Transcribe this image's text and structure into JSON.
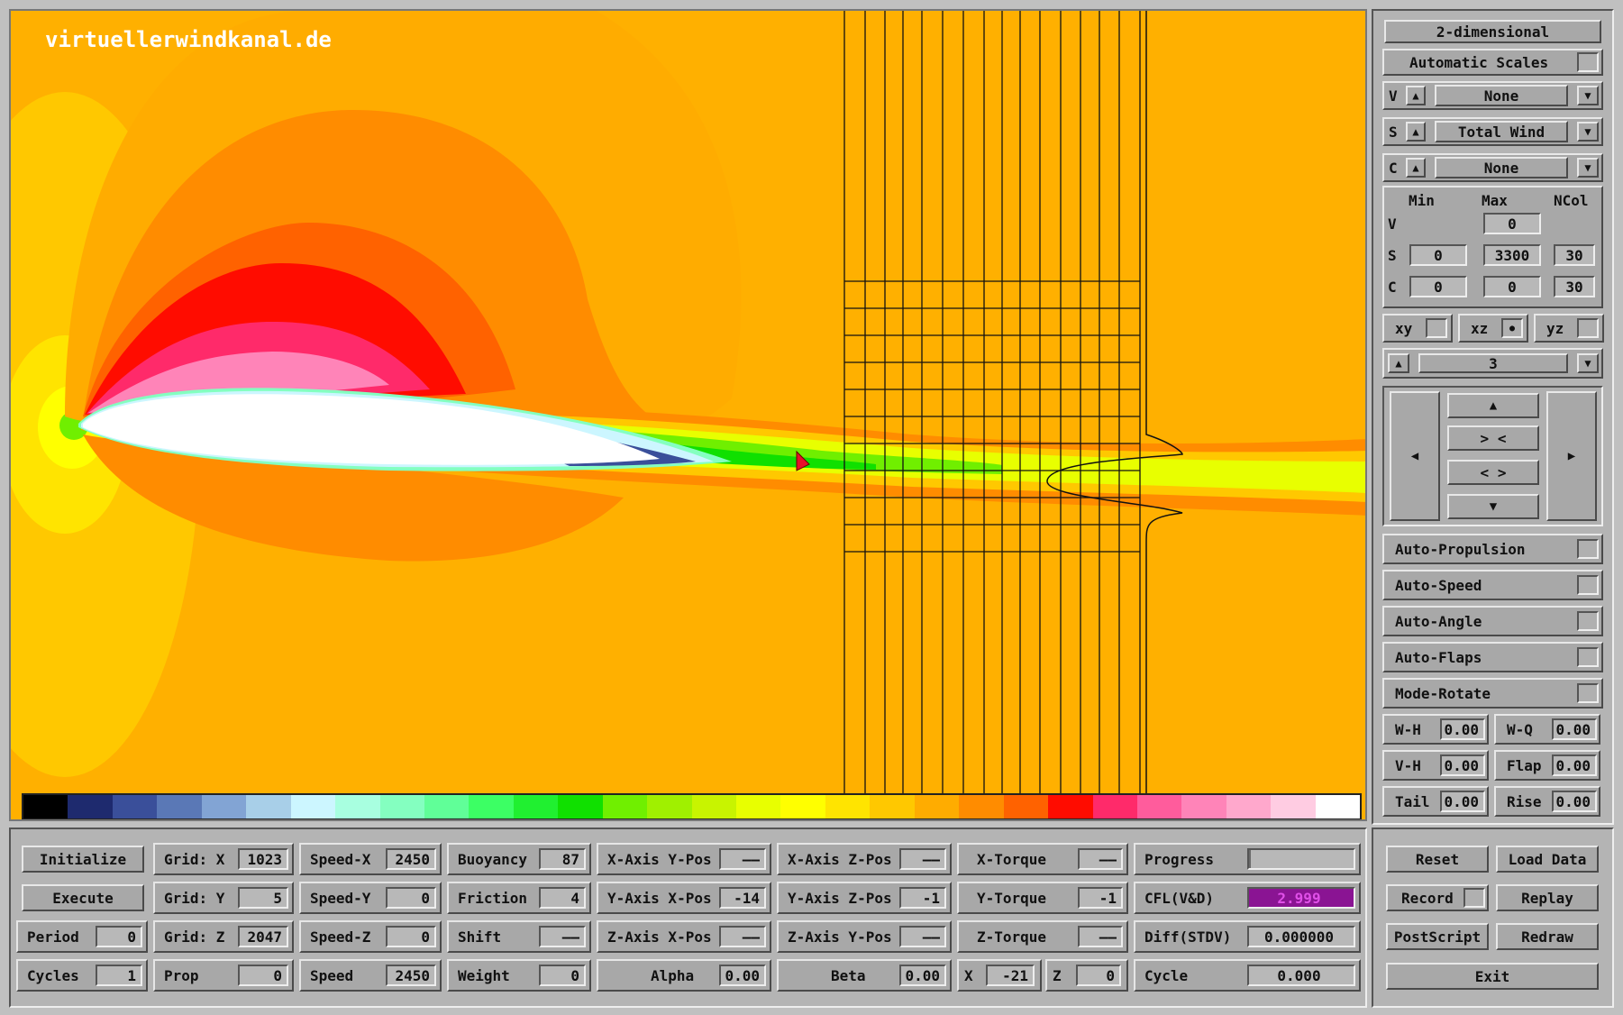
{
  "watermark": "virtuellerwindkanal.de",
  "colors": {
    "background": "#ffb000",
    "purple_field": "#8a1493",
    "palette": [
      "#000000",
      "#1e2a6e",
      "#3a4f9a",
      "#5a78b6",
      "#82a4d4",
      "#a8cfe8",
      "#ccf6ff",
      "#a8ffe0",
      "#84ffc0",
      "#60ff98",
      "#3cff64",
      "#20f030",
      "#10e000",
      "#70ef00",
      "#a0f000",
      "#c8f400",
      "#e8ff00",
      "#ffff00",
      "#ffe400",
      "#ffc800",
      "#ffac00",
      "#ff8c00",
      "#ff6200",
      "#ff0c00",
      "#ff2a6a",
      "#ff5c9c",
      "#ff84b8",
      "#ffa8cc",
      "#ffcce2",
      "#ffffff"
    ]
  },
  "right_panel": {
    "mode_button": "2-dimensional",
    "auto_scales": "Automatic Scales",
    "selectors": [
      {
        "letter": "V",
        "value": "None"
      },
      {
        "letter": "S",
        "value": "Total Wind"
      },
      {
        "letter": "C",
        "value": "None"
      }
    ],
    "scale_headers": {
      "min": "Min",
      "max": "Max",
      "ncol": "NCol"
    },
    "scale_rows": [
      {
        "letter": "V",
        "min": "",
        "max": "0",
        "ncol": ""
      },
      {
        "letter": "S",
        "min": "0",
        "max": "3300",
        "ncol": "30"
      },
      {
        "letter": "C",
        "min": "0",
        "max": "0",
        "ncol": "30"
      }
    ],
    "planes": [
      {
        "label": "xy",
        "checked": false
      },
      {
        "label": "xz",
        "checked": true
      },
      {
        "label": "yz",
        "checked": false
      }
    ],
    "slice_value": "3",
    "nav": {
      "up": "▲",
      "zoom_in": "> <",
      "zoom_out": "< >",
      "down": "▼",
      "left": "◀",
      "right": "▶"
    },
    "toggles": [
      "Auto-Propulsion",
      "Auto-Speed",
      "Auto-Angle",
      "Auto-Flaps",
      "Mode-Rotate"
    ],
    "params": [
      [
        {
          "label": "W-H",
          "value": "0.00"
        },
        {
          "label": "W-Q",
          "value": "0.00"
        }
      ],
      [
        {
          "label": "V-H",
          "value": "0.00"
        },
        {
          "label": "Flap",
          "value": "0.00"
        }
      ],
      [
        {
          "label": "Tail",
          "value": "0.00"
        },
        {
          "label": "Rise",
          "value": "0.00"
        }
      ]
    ]
  },
  "bottom": {
    "buttons": {
      "initialize": "Initialize",
      "execute": "Execute"
    },
    "col0": [
      {
        "label": "Period",
        "value": "0"
      },
      {
        "label": "Cycles",
        "value": "1"
      }
    ],
    "col1": [
      {
        "label": "Grid: X",
        "value": "1023"
      },
      {
        "label": "Grid: Y",
        "value": "5"
      },
      {
        "label": "Grid: Z",
        "value": "2047"
      },
      {
        "label": "Prop",
        "value": "0"
      }
    ],
    "col2": [
      {
        "label": "Speed-X",
        "value": "2450"
      },
      {
        "label": "Speed-Y",
        "value": "0"
      },
      {
        "label": "Speed-Z",
        "value": "0"
      },
      {
        "label": "Speed",
        "value": "2450"
      }
    ],
    "col3": [
      {
        "label": "Buoyancy",
        "value": "87"
      },
      {
        "label": "Friction",
        "value": "4"
      },
      {
        "label": "Shift",
        "value": "——"
      },
      {
        "label": "Weight",
        "value": "0"
      }
    ],
    "col4": [
      {
        "label": "X-Axis Y-Pos",
        "value": "——"
      },
      {
        "label": "Y-Axis X-Pos",
        "value": "-14"
      },
      {
        "label": "Z-Axis X-Pos",
        "value": "——"
      },
      {
        "label": "Alpha",
        "value": "0.00"
      }
    ],
    "col5": [
      {
        "label": "X-Axis Z-Pos",
        "value": "——"
      },
      {
        "label": "Y-Axis Z-Pos",
        "value": "-1"
      },
      {
        "label": "Z-Axis Y-Pos",
        "value": "——"
      },
      {
        "label": "Beta",
        "value": "0.00"
      }
    ],
    "col6": [
      {
        "label": "X-Torque",
        "value": "——"
      },
      {
        "label": "Y-Torque",
        "value": "-1"
      },
      {
        "label": "Z-Torque",
        "value": "——"
      }
    ],
    "xz": {
      "x_label": "X",
      "x_value": "-21",
      "z_label": "Z",
      "z_value": "0"
    },
    "col7": [
      {
        "label": "Progress",
        "value": "",
        "progress": 0.0
      },
      {
        "label": "CFL(V&D)",
        "value": "2.999"
      },
      {
        "label": "Diff(STDV)",
        "value": "0.000000"
      },
      {
        "label": "Cycle",
        "value": "0.000"
      }
    ],
    "actions": {
      "reset": "Reset",
      "load": "Load Data",
      "record": "Record",
      "replay": "Replay",
      "postscript": "PostScript",
      "redraw": "Redraw",
      "exit": "Exit"
    }
  }
}
